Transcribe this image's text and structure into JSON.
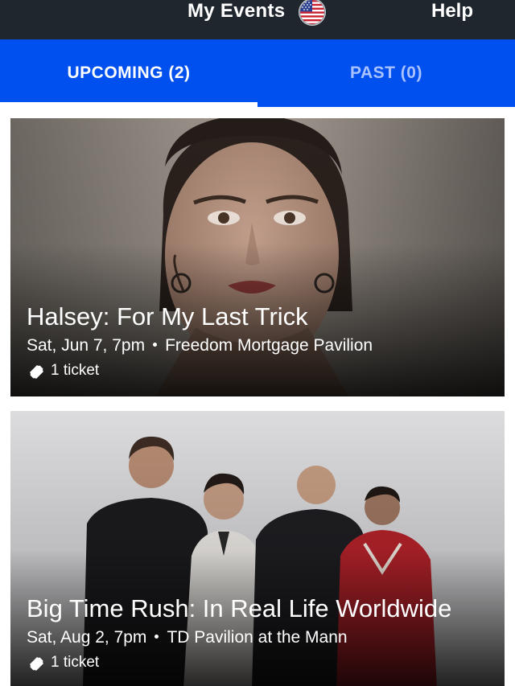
{
  "header": {
    "title": "My Events",
    "help_label": "Help",
    "flag_icon": "us-flag-icon"
  },
  "tabs": [
    {
      "label": "UPCOMING (2)",
      "active": true
    },
    {
      "label": "PAST (0)",
      "active": false
    }
  ],
  "events": [
    {
      "title": "Halsey: For My Last Trick",
      "date": "Sat, Jun 7, 7pm",
      "venue": "Freedom Mortgage Pavilion",
      "tickets": "1 ticket"
    },
    {
      "title": "Big Time Rush: In Real Life Worldwide",
      "date": "Sat, Aug 2, 7pm",
      "venue": "TD Pavilion at the Mann",
      "tickets": "1 ticket"
    }
  ],
  "colors": {
    "header_bg": "#1f262d",
    "tab_bar_bg": "#0050f0",
    "active_tab_text": "#ffffff",
    "inactive_tab_text": "#a9c2ff"
  }
}
